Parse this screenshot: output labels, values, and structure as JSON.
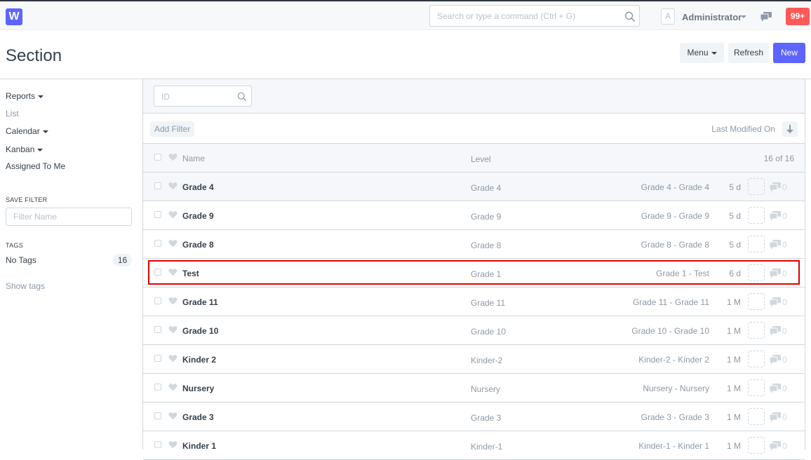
{
  "app": {
    "logo_letter": "W"
  },
  "topbar": {
    "search_placeholder": "Search or type a command (Ctrl + G)",
    "avatar_letter": "A",
    "user_name": "Administrator",
    "notifications": "99+"
  },
  "page": {
    "title": "Section",
    "menu_label": "Menu",
    "refresh_label": "Refresh",
    "new_label": "New"
  },
  "sidebar": {
    "reports": "Reports",
    "list": "List",
    "calendar": "Calendar",
    "kanban": "Kanban",
    "assigned": "Assigned To Me",
    "save_filter_heading": "SAVE FILTER",
    "filter_name_placeholder": "Filter Name",
    "tags_heading": "TAGS",
    "no_tags": "No Tags",
    "no_tags_count": "16",
    "show_tags": "Show tags"
  },
  "list": {
    "id_placeholder": "ID",
    "add_filter": "Add Filter",
    "sort_label": "Last Modified On",
    "header": {
      "name": "Name",
      "level": "Level",
      "count": "16 of 16"
    },
    "rows": [
      {
        "name": "Grade 4",
        "level": "Grade 4",
        "title": "Grade 4 - Grade 4",
        "age": "5 d",
        "comments": "0"
      },
      {
        "name": "Grade 9",
        "level": "Grade 9",
        "title": "Grade 9 - Grade 9",
        "age": "5 d",
        "comments": "0"
      },
      {
        "name": "Grade 8",
        "level": "Grade 8",
        "title": "Grade 8 - Grade 8",
        "age": "5 d",
        "comments": "0"
      },
      {
        "name": "Test",
        "level": "Grade 1",
        "title": "Grade 1 - Test",
        "age": "6 d",
        "comments": "0"
      },
      {
        "name": "Grade 11",
        "level": "Grade 11",
        "title": "Grade 11 - Grade 11",
        "age": "1 M",
        "comments": "0"
      },
      {
        "name": "Grade 10",
        "level": "Grade 10",
        "title": "Grade 10 - Grade 10",
        "age": "1 M",
        "comments": "0"
      },
      {
        "name": "Kinder 2",
        "level": "Kinder-2",
        "title": "Kinder-2 - Kinder 2",
        "age": "1 M",
        "comments": "0"
      },
      {
        "name": "Nursery",
        "level": "Nursery",
        "title": "Nursery - Nursery",
        "age": "1 M",
        "comments": "0"
      },
      {
        "name": "Grade 3",
        "level": "Grade 3",
        "title": "Grade 3 - Grade 3",
        "age": "1 M",
        "comments": "0"
      },
      {
        "name": "Kinder 1",
        "level": "Kinder-1",
        "title": "Kinder-1 - Kinder 1",
        "age": "1 M",
        "comments": "0"
      }
    ]
  },
  "colors": {
    "accent": "#5e64ff",
    "notification": "#ff5858",
    "highlight": "#e00000"
  }
}
